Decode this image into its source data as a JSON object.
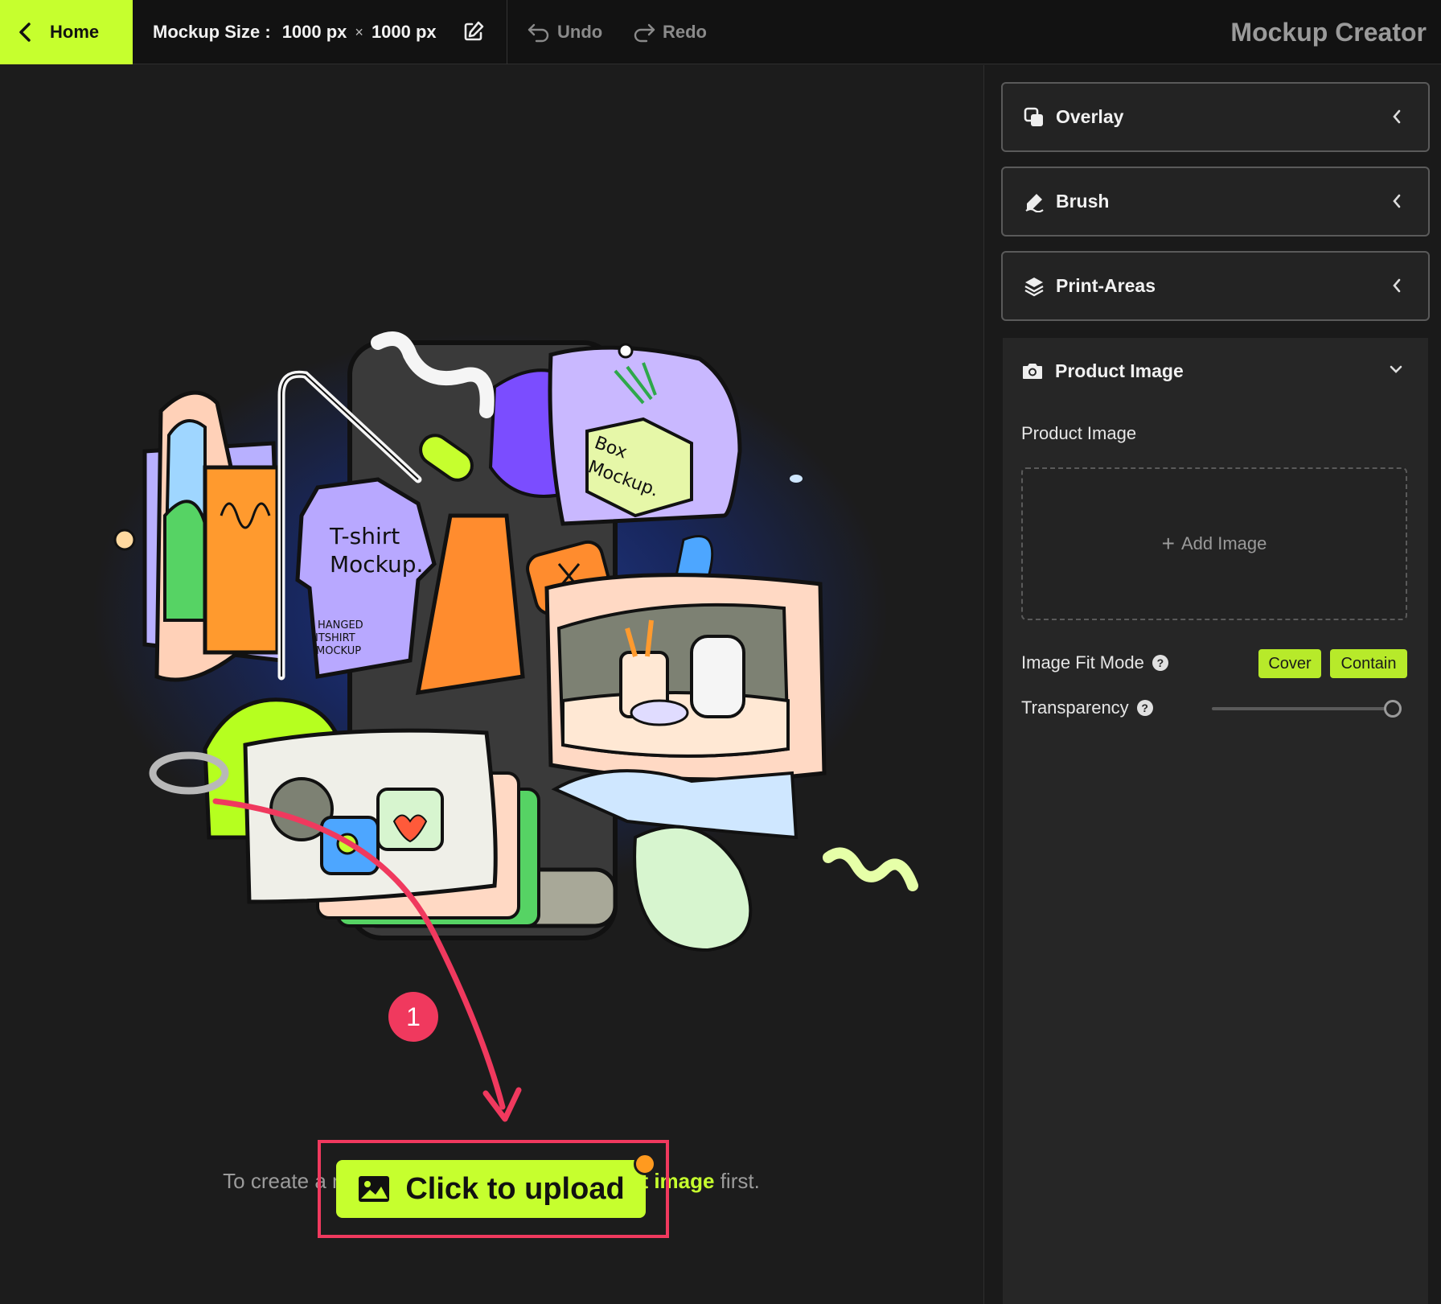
{
  "header": {
    "home_label": "Home",
    "mockup_size_label": "Mockup Size :",
    "width_value": "1000 px",
    "times_symbol": "×",
    "height_value": "1000 px",
    "undo_label": "Undo",
    "redo_label": "Redo",
    "app_title": "Mockup Creator"
  },
  "canvas": {
    "hint_prefix": "To create a mockup, please upload a ",
    "hint_highlight": "product image",
    "hint_suffix": " first.",
    "upload_label": "Click to upload",
    "step_number": "1"
  },
  "sidebar": {
    "sections": [
      {
        "label": "Overlay",
        "icon": "overlay-icon",
        "state": "collapsed"
      },
      {
        "label": "Brush",
        "icon": "brush-icon",
        "state": "collapsed"
      },
      {
        "label": "Print-Areas",
        "icon": "layers-icon",
        "state": "collapsed"
      }
    ],
    "product_panel": {
      "title": "Product Image",
      "icon": "camera-icon",
      "field_label": "Product Image",
      "add_image_label": "Add Image",
      "fit_mode_label": "Image Fit Mode",
      "fit_options": [
        "Cover",
        "Contain"
      ],
      "transparency_label": "Transparency",
      "transparency_value": 1.0
    }
  },
  "colors": {
    "accent": "#c6ff2e",
    "annotation": "#f0395e",
    "notification": "#ff9a1f"
  }
}
